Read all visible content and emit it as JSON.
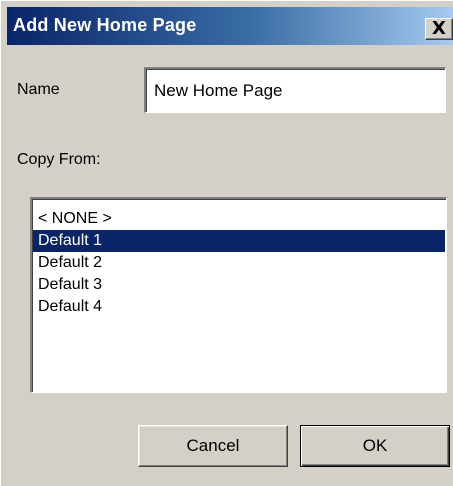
{
  "dialog": {
    "title": "Add New Home Page",
    "close_glyph": "X"
  },
  "form": {
    "name_label": "Name",
    "name_value": "New Home Page",
    "copy_from_label": "Copy From:"
  },
  "list": {
    "items": [
      {
        "label": "< NONE >",
        "selected": false
      },
      {
        "label": "Default 1",
        "selected": true
      },
      {
        "label": "Default 2",
        "selected": false
      },
      {
        "label": "Default 3",
        "selected": false
      },
      {
        "label": "Default 4",
        "selected": false
      }
    ]
  },
  "buttons": {
    "cancel_label": "Cancel",
    "ok_label": "OK"
  },
  "colors": {
    "title_bar_start": "#0a246a",
    "title_bar_end": "#a6caf0",
    "selection": "#0a246a",
    "dialog_face": "#d4d0c8"
  }
}
